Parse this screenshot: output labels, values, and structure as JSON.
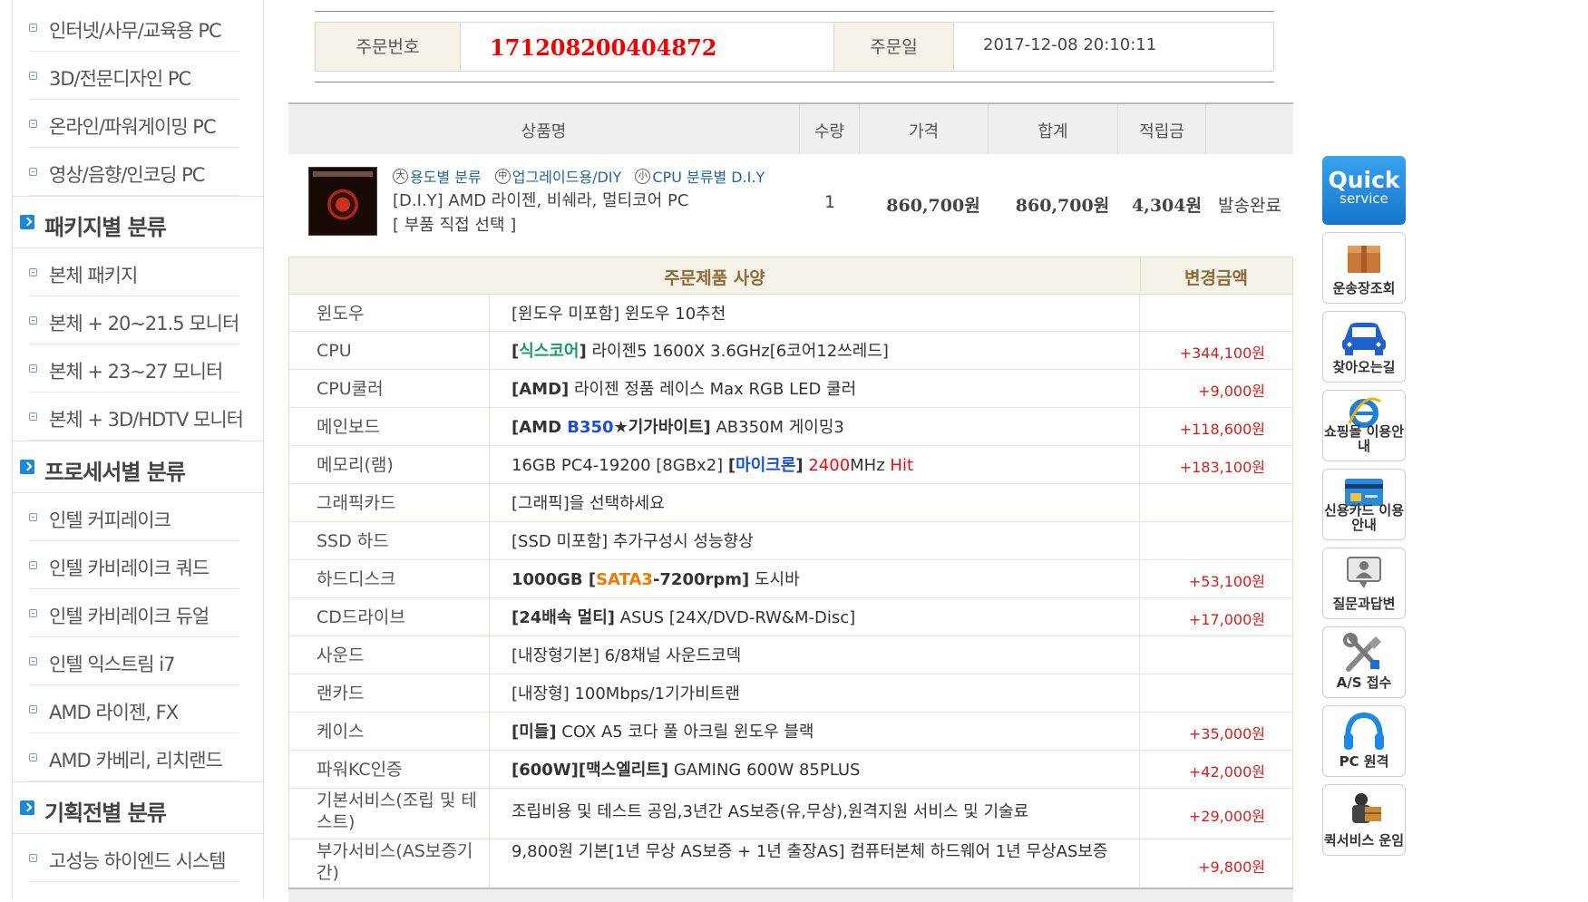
{
  "sidebar": {
    "groups": [
      {
        "type": "item",
        "label": "인터넷/사무/교육용 PC"
      },
      {
        "type": "item",
        "label": "3D/전문디자인 PC"
      },
      {
        "type": "item",
        "label": "온라인/파워게이밍 PC"
      },
      {
        "type": "item",
        "label": "영상/음향/인코딩 PC"
      },
      {
        "type": "head",
        "label": "패키지별 분류"
      },
      {
        "type": "item",
        "label": "본체 패키지"
      },
      {
        "type": "item",
        "label": "본체 + 20~21.5 모니터"
      },
      {
        "type": "item",
        "label": "본체 + 23~27 모니터"
      },
      {
        "type": "item",
        "label": "본체 + 3D/HDTV 모니터"
      },
      {
        "type": "head",
        "label": "프로세서별 분류"
      },
      {
        "type": "item",
        "label": "인텔 커피레이크"
      },
      {
        "type": "item",
        "label": "인텔 카비레이크 쿼드"
      },
      {
        "type": "item",
        "label": "인텔 카비레이크 듀얼"
      },
      {
        "type": "item",
        "label": "인텔 익스트림 i7"
      },
      {
        "type": "item",
        "label": "AMD 라이젠, FX"
      },
      {
        "type": "item",
        "label": "AMD 카베리, 리치랜드"
      },
      {
        "type": "head",
        "label": "기획전별 분류"
      },
      {
        "type": "item",
        "label": "고성능 하이엔드 시스템"
      }
    ]
  },
  "order": {
    "number_label": "주문번호",
    "number": "171208200404872",
    "date_label": "주문일",
    "date": "2017-12-08 20:10:11"
  },
  "product_table": {
    "headers": [
      "상품명",
      "수량",
      "가격",
      "합계",
      "적립금"
    ],
    "categories": [
      {
        "badge": "大",
        "text": "용도별 분류"
      },
      {
        "badge": "中",
        "text": "업그레이드용/DIY"
      },
      {
        "badge": "小",
        "text": "CPU 분류별 D.I.Y"
      }
    ],
    "name": "[D.I.Y] AMD 라이젠, 비쉐라, 멀티코어 PC",
    "option": "[ 부품 직접 선택 ]",
    "qty": "1",
    "price": "860,700원",
    "total": "860,700원",
    "points": "4,304원",
    "status": "발송완료"
  },
  "spec_table": {
    "header_spec": "주문제품 사양",
    "header_price": "변경금액",
    "rows": [
      {
        "name": "윈도우",
        "pre": "",
        "b1": "",
        "mid": "[윈도우 미포함] 윈도우 10추천",
        "price": ""
      },
      {
        "name": "CPU",
        "b_open": "[",
        "hl": "식스코어",
        "b_close": "]",
        "mid": " 라이젠5 1600X 3.6GHz[6코어12쓰레드]",
        "price": "+344,100원"
      },
      {
        "name": "CPU쿨러",
        "bold": "[AMD]",
        "mid": " 라이젠 정품 레이스 Max RGB LED 쿨러",
        "price": "+9,000원"
      },
      {
        "name": "메인보드",
        "bold1": "[AMD ",
        "hl": "B350",
        "bold2": "★기가바이트]",
        "mid": " AB350M 게이밍3",
        "price": "+118,600원"
      },
      {
        "name": "메모리(램)",
        "pre": "16GB PC4-19200 [8GBx2] ",
        "b_open": "[",
        "hl": "마이크론",
        "b_close": "]",
        "red1": " 2400",
        "mid": "MHz ",
        "red2": "Hit",
        "price": "+183,100원"
      },
      {
        "name": "그래픽카드",
        "mid": "[그래픽]을 선택하세요",
        "price": ""
      },
      {
        "name": "SSD 하드",
        "mid": "[SSD 미포함] 추가구성시 성능향상",
        "price": ""
      },
      {
        "name": "하드디스크",
        "bold1": "1000GB [",
        "hl": "SATA3",
        "bold2": "-7200rpm]",
        "mid": " 도시바",
        "price": "+53,100원"
      },
      {
        "name": "CD드라이브",
        "bold": "[24배속 멀티]",
        "mid": " ASUS [24X/DVD-RW&M-Disc]",
        "price": "+17,000원"
      },
      {
        "name": "사운드",
        "mid": "[내장형기본] 6/8채널 사운드코덱",
        "price": ""
      },
      {
        "name": "랜카드",
        "mid": "[내장형] 100Mbps/1기가비트랜",
        "price": ""
      },
      {
        "name": "케이스",
        "bold": "[미들]",
        "mid": " COX A5 코다 풀 아크릴 윈도우 블랙",
        "price": "+35,000원"
      },
      {
        "name": "파워KC인증",
        "bold": "[600W][맥스엘리트]",
        "mid": " GAMING 600W 85PLUS",
        "price": "+42,000원"
      },
      {
        "name": "기본서비스(조립 및 테스트)",
        "mid": "조립비용 및 테스트 공임,3년간 AS보증(유,무상),원격지원 서비스 및 기술료",
        "price": "+29,000원"
      },
      {
        "name": "부가서비스(AS보증기간)",
        "mid": "9,800원 기본[1년 무상 AS보증 + 1년 출장AS] 컴퓨터본체 하드웨어 1년 무상AS보증",
        "price": "+9,800원"
      }
    ]
  },
  "quick": {
    "title": "Quick",
    "sub": "service",
    "items": [
      {
        "label": "운송장조회",
        "icon": "box-icon"
      },
      {
        "label": "찾아오는길",
        "icon": "car-icon"
      },
      {
        "label": "쇼핑몰 이용안내",
        "icon": "ie-icon"
      },
      {
        "label": "신용카드 이용안내",
        "icon": "credit-card-icon"
      },
      {
        "label": "질문과답변",
        "icon": "qna-icon"
      },
      {
        "label": "A/S 접수",
        "icon": "tools-icon"
      },
      {
        "label": "PC 원격",
        "icon": "headset-icon"
      },
      {
        "label": "퀵서비스 운임",
        "icon": "courier-icon"
      }
    ]
  },
  "colors": {
    "accent": "#1e88d6",
    "price_red": "#e00000",
    "header_bg": "#f6f2e8"
  }
}
